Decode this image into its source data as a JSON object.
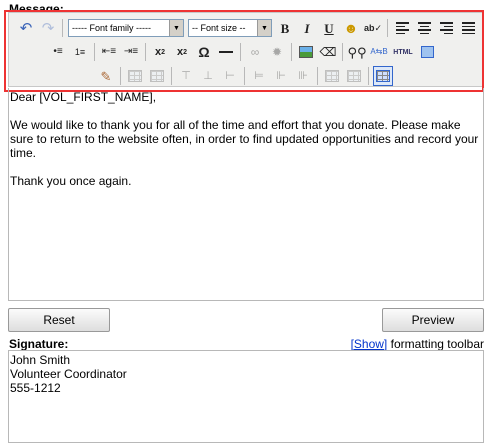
{
  "message": {
    "label": "Message:",
    "font_family_select": "----- Font family -----",
    "font_size_select": "-- Font size --",
    "html_button": "HTML",
    "body": [
      "Dear [VOL_FIRST_NAME],",
      "We would like to thank you for all of the time and effort that you donate. Please make sure to return to the website often, in order to find updated opportunities and record your time.",
      "Thank  you once again."
    ]
  },
  "buttons": {
    "reset": "Reset",
    "preview": "Preview"
  },
  "signature": {
    "label": "Signature:",
    "show_link": "[Show]",
    "toolbar_text": "formatting toolbar",
    "lines": [
      "John Smith",
      "Volunteer Coordinator",
      "555-1212"
    ]
  },
  "colors": {
    "highlight": "#ee3333",
    "link": "#0033cc",
    "toolbar_bg": "#f0f0ee"
  },
  "icons": {
    "row1": [
      "undo-icon",
      "redo-icon",
      "bold-icon",
      "italic-icon",
      "underline-icon",
      "emoticon-icon",
      "spellcheck-icon",
      "align-left-icon",
      "align-center-icon",
      "align-right-icon",
      "align-justify-icon"
    ],
    "row2": [
      "bullet-list-icon",
      "numbered-list-icon",
      "outdent-icon",
      "indent-icon",
      "subscript-icon",
      "superscript-icon",
      "special-char-icon",
      "horizontal-rule-icon",
      "link-icon",
      "unlink-icon",
      "image-icon",
      "cleanup-icon",
      "find-icon",
      "replace-icon",
      "html-source-icon",
      "fullscreen-icon"
    ],
    "row3": [
      "style-props-icon",
      "table-row-props-icon",
      "table-cell-props-icon",
      "insert-row-before-icon",
      "insert-row-after-icon",
      "delete-row-icon",
      "insert-col-before-icon",
      "insert-col-after-icon",
      "delete-col-icon",
      "split-cells-icon",
      "merge-cells-icon",
      "insert-table-icon"
    ]
  }
}
